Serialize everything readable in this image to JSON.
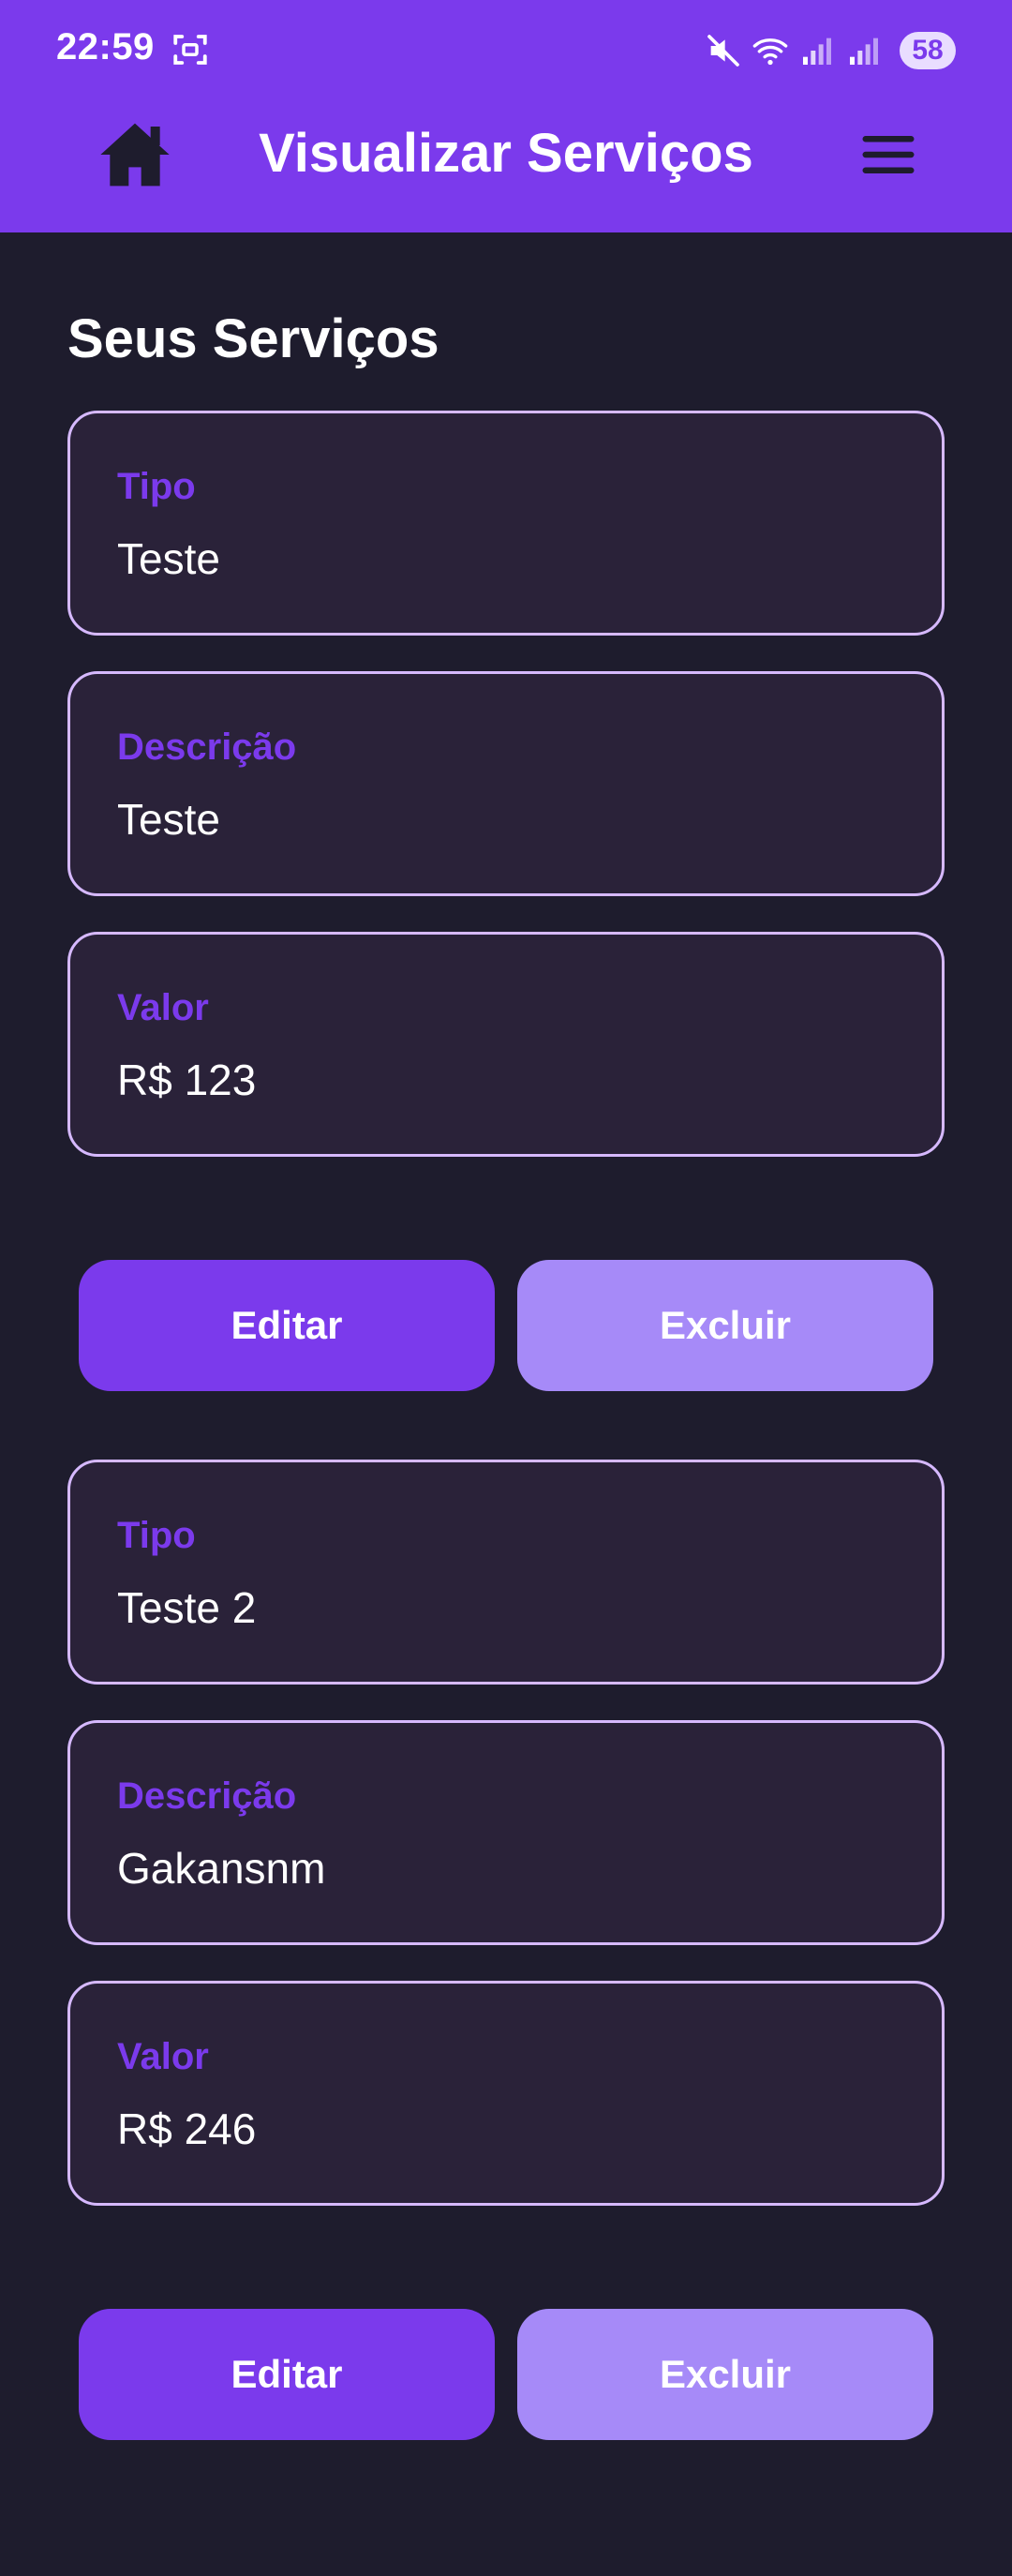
{
  "status_bar": {
    "time": "22:59",
    "battery": "58"
  },
  "header": {
    "title": "Visualizar Serviços"
  },
  "page": {
    "section_title": "Seus Serviços"
  },
  "services": [
    {
      "tipo_label": "Tipo",
      "tipo_value": "Teste",
      "descricao_label": "Descrição",
      "descricao_value": "Teste",
      "valor_label": "Valor",
      "valor_value": "R$ 123",
      "edit_label": "Editar",
      "delete_label": "Excluir"
    },
    {
      "tipo_label": "Tipo",
      "tipo_value": "Teste 2",
      "descricao_label": "Descrição",
      "descricao_value": "Gakansnm",
      "valor_label": "Valor",
      "valor_value": "R$ 246",
      "edit_label": "Editar",
      "delete_label": "Excluir"
    }
  ],
  "colors": {
    "primary": "#7b3aec",
    "secondary": "#a68af8",
    "background": "#1e1c2d",
    "card_background": "#2a2239",
    "card_border": "#d6b9ff"
  },
  "icons": {
    "home": "home-icon",
    "menu": "hamburger-menu-icon",
    "mute": "mute-icon",
    "wifi": "wifi-icon",
    "signal": "signal-icon",
    "screenshot": "screenshot-icon"
  }
}
